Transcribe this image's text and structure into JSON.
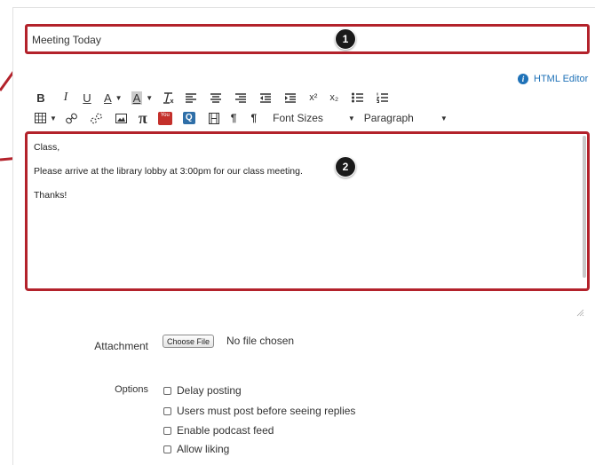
{
  "title_field": {
    "value": "Meeting Today",
    "callout": "1"
  },
  "html_editor": {
    "label": "HTML Editor"
  },
  "toolbar": {
    "row1": {
      "bold": "B",
      "italic": "I",
      "underline": "U",
      "text_color": "A",
      "background_color": "A",
      "superscript": "x²",
      "subscript": "x₂"
    },
    "row2": {
      "pi": "π",
      "youtube": "You",
      "quiz": "Q",
      "pilcrow_ltr": "¶",
      "pilcrow_rtl": "¶",
      "font_sizes": "Font Sizes",
      "paragraph": "Paragraph"
    }
  },
  "body_field": {
    "lines": [
      "Class,",
      "Please arrive at the library lobby at 3:00pm for our class meeting.",
      "Thanks!"
    ],
    "callout": "2"
  },
  "attachment": {
    "label": "Attachment",
    "button": "Choose File",
    "status": "No file chosen"
  },
  "options": {
    "label": "Options",
    "items": [
      "Delay posting",
      "Users must post before seeing replies",
      "Enable podcast feed",
      "Allow liking"
    ]
  },
  "colors": {
    "accent_red": "#b3222b",
    "link_blue": "#1f72b8"
  }
}
